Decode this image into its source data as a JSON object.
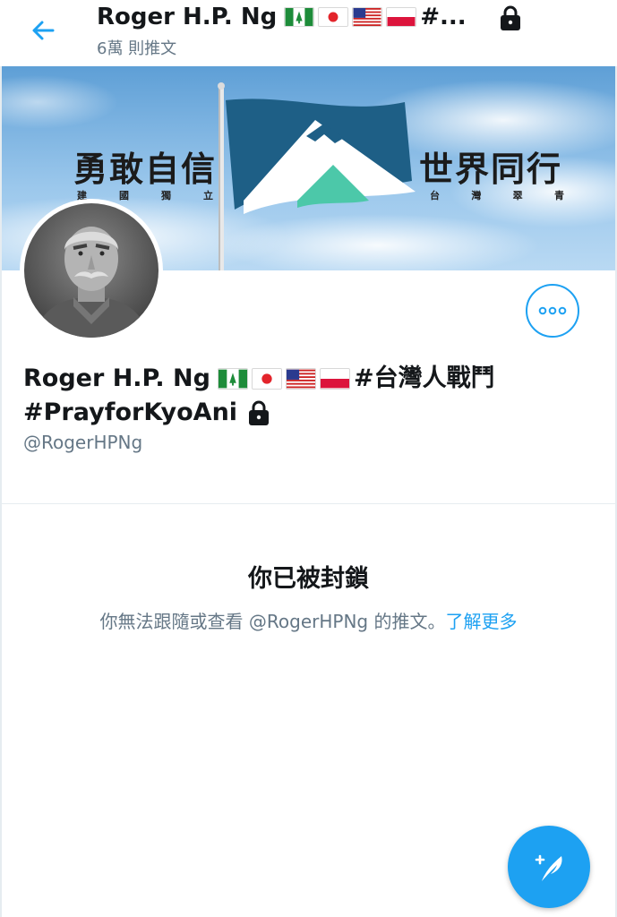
{
  "header": {
    "back_icon": "arrow-left-icon",
    "title": "Roger H.P. Ng",
    "title_flags": [
      "norfolk-island-flag",
      "japan-flag",
      "usa-flag",
      "poland-flag"
    ],
    "title_suffix": "#...",
    "subtitle": "6萬 則推文",
    "lock_icon": "lock-icon"
  },
  "banner": {
    "left_slogan": "勇敢自信",
    "left_sub": [
      "建",
      "國",
      "獨",
      "立"
    ],
    "right_slogan": "世界同行",
    "right_sub": [
      "台",
      "灣",
      "翠",
      "青"
    ]
  },
  "profile": {
    "avatar_alt": "avatar",
    "more_icon": "more-options-icon",
    "name": "Roger H.P. Ng",
    "flags": [
      "norfolk-island-flag",
      "japan-flag",
      "usa-flag",
      "poland-flag"
    ],
    "name_suffix": "#台灣人戰鬥",
    "name_line2": "#PrayforKyoAni",
    "handle": "@RogerHPNg"
  },
  "blocked": {
    "title": "你已被封鎖",
    "description": "你無法跟隨或查看 @RogerHPNg 的推文。",
    "learn_more": "了解更多"
  },
  "fab": {
    "icon": "compose-tweet-icon"
  },
  "colors": {
    "accent": "#1da1f2",
    "text_primary": "#14171a",
    "text_secondary": "#657786",
    "divider": "#e6ecf0"
  }
}
